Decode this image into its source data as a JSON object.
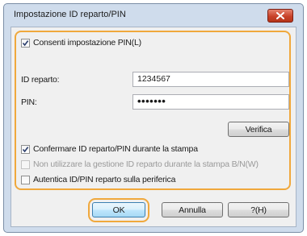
{
  "dialog": {
    "title": "Impostazione ID reparto/PIN",
    "close_icon": "close-icon"
  },
  "options": {
    "allow_pin": {
      "label": "Consenti impostazione PIN(L)",
      "checked": true
    }
  },
  "fields": {
    "dept_id": {
      "label": "ID reparto:",
      "value": "1234567"
    },
    "pin": {
      "label": "PIN:",
      "value": "•••••••"
    }
  },
  "buttons": {
    "verify": "Verifica",
    "ok": "OK",
    "cancel": "Annulla",
    "help": "?(H)"
  },
  "checks": {
    "confirm_on_print": {
      "label": "Confermare ID reparto/PIN durante la stampa",
      "checked": true
    },
    "disable_bw": {
      "label": "Non utilizzare la gestione ID reparto durante la stampa B/N(W)",
      "checked": false,
      "enabled": false
    },
    "auth_device": {
      "label": "Autentica ID/PIN reparto sulla periferica",
      "checked": false
    }
  },
  "colors": {
    "highlight": "#f0a83c",
    "close_button": "#c9432a"
  }
}
